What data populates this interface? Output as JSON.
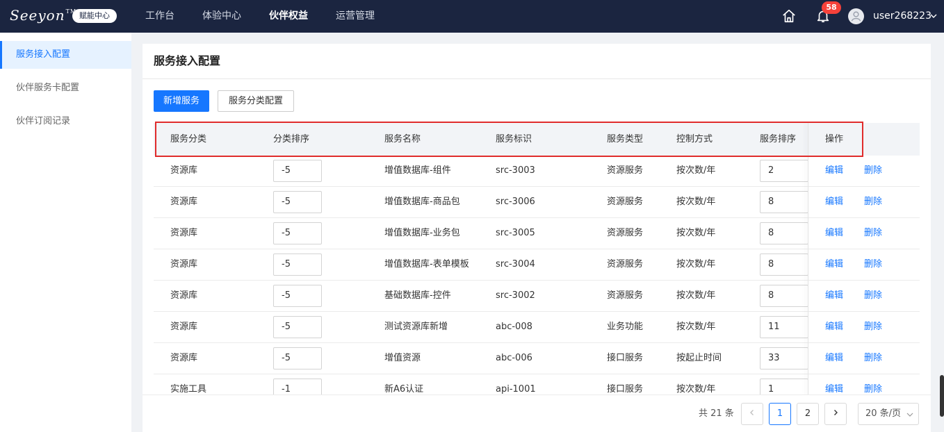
{
  "header": {
    "logo_text": "Seeyon",
    "logo_tm": "TM",
    "logo_badge": "赋能中心",
    "nav": [
      "工作台",
      "体验中心",
      "伙伴权益",
      "运营管理"
    ],
    "active_nav": "伙伴权益",
    "notification_count": "58",
    "username": "user268223"
  },
  "sidebar": {
    "items": [
      "服务接入配置",
      "伙伴服务卡配置",
      "伙伴订阅记录"
    ],
    "active": "服务接入配置"
  },
  "main": {
    "title": "服务接入配置",
    "add_button": "新增服务",
    "category_config_button": "服务分类配置"
  },
  "table": {
    "columns": [
      "服务分类",
      "分类排序",
      "服务名称",
      "服务标识",
      "服务类型",
      "控制方式",
      "服务排序",
      "操作"
    ],
    "edit_label": "编辑",
    "delete_label": "删除",
    "rows": [
      {
        "category": "资源库",
        "category_order": "-5",
        "name": "增值数据库-组件",
        "id": "src-3003",
        "type": "资源服务",
        "control": "按次数/年",
        "order": "2"
      },
      {
        "category": "资源库",
        "category_order": "-5",
        "name": "增值数据库-商品包",
        "id": "src-3006",
        "type": "资源服务",
        "control": "按次数/年",
        "order": "8"
      },
      {
        "category": "资源库",
        "category_order": "-5",
        "name": "增值数据库-业务包",
        "id": "src-3005",
        "type": "资源服务",
        "control": "按次数/年",
        "order": "8"
      },
      {
        "category": "资源库",
        "category_order": "-5",
        "name": "增值数据库-表单模板",
        "id": "src-3004",
        "type": "资源服务",
        "control": "按次数/年",
        "order": "8"
      },
      {
        "category": "资源库",
        "category_order": "-5",
        "name": "基础数据库-控件",
        "id": "src-3002",
        "type": "资源服务",
        "control": "按次数/年",
        "order": "8"
      },
      {
        "category": "资源库",
        "category_order": "-5",
        "name": "测试资源库新增",
        "id": "abc-008",
        "type": "业务功能",
        "control": "按次数/年",
        "order": "11"
      },
      {
        "category": "资源库",
        "category_order": "-5",
        "name": "增值资源",
        "id": "abc-006",
        "type": "接口服务",
        "control": "按起止时间",
        "order": "33"
      },
      {
        "category": "实施工具",
        "category_order": "-1",
        "name": "新A6认证",
        "id": "api-1001",
        "type": "接口服务",
        "control": "按次数/年",
        "order": "1"
      }
    ]
  },
  "pagination": {
    "total": "共 21 条",
    "pages": [
      "1",
      "2"
    ],
    "current": "1",
    "page_size": "20 条/页"
  },
  "colors": {
    "topbar": "#1b2540",
    "accent": "#1677ff",
    "highlight": "#e02b2b",
    "badge": "#f5413a"
  }
}
